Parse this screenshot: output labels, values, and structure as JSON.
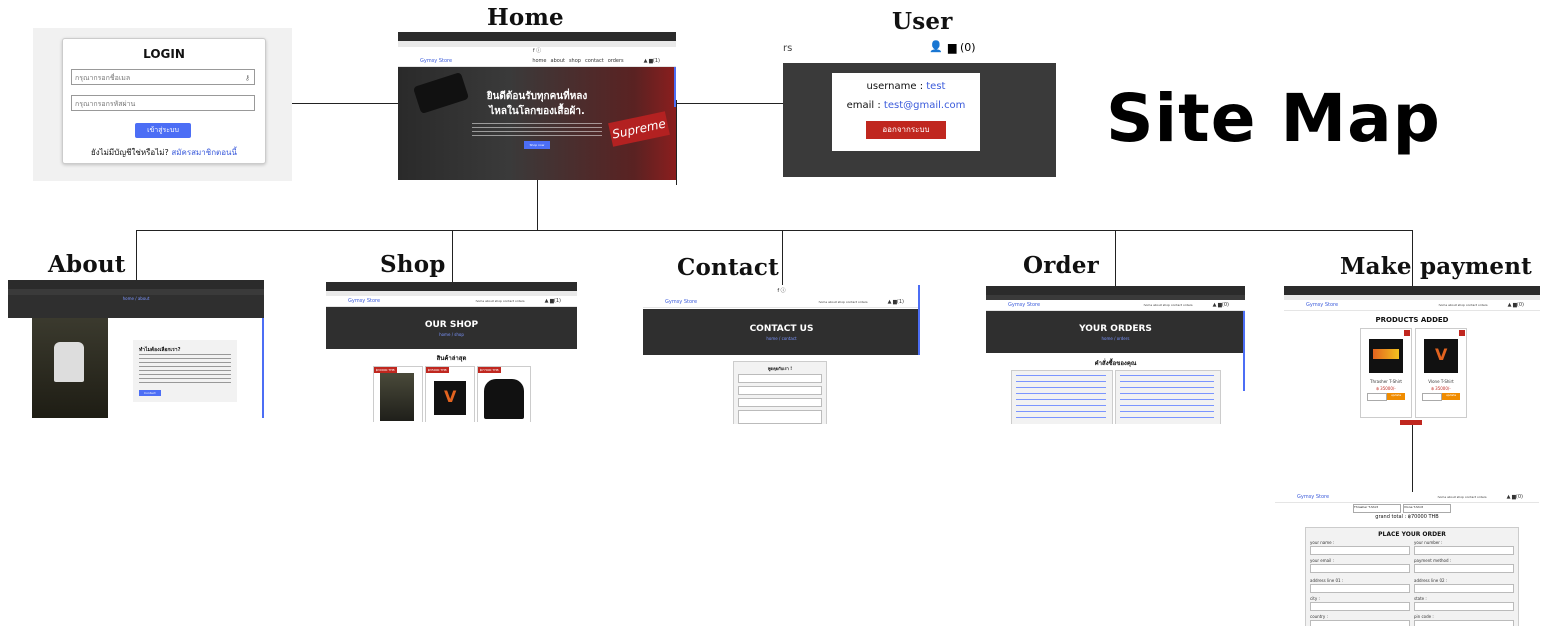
{
  "title": "Site Map",
  "labels": {
    "home": "Home",
    "user": "User",
    "about": "About",
    "shop": "Shop",
    "contact": "Contact",
    "order": "Order",
    "payment": "Make payment"
  },
  "login": {
    "title": "LOGIN",
    "username_placeholder": "กรุณากรอกชื่อเมล",
    "password_placeholder": "กรุณากรอกรหัสผ่าน",
    "submit": "เข้าสู่ระบบ",
    "no_account": "ยังไม่มีบัญชีใช่หรือไม่?",
    "register_link": "สมัครสมาชิกตอนนี้"
  },
  "home": {
    "brand": "Gymsy Store",
    "nav": [
      "home",
      "about",
      "shop",
      "contact",
      "orders"
    ],
    "cart": "(1)",
    "hero_title_1": "ยินดีต้อนรับทุกคนที่หลง",
    "hero_title_2": "ไหลในโลกของเสื้อผ้า.",
    "hero_button": "Shop now"
  },
  "user": {
    "nav_fragment": "rs",
    "cart": "(0)",
    "username_label": "username :",
    "username_value": "test",
    "email_label": "email :",
    "email_value": "test@gmail.com",
    "logout": "ออกจากระบบ"
  },
  "about": {
    "heading": "ทำไมต้องเลือกเรา?",
    "crumb": "home / about",
    "button": "Contact"
  },
  "shop": {
    "brand": "Gymsy Store",
    "hero_title": "OUR SHOP",
    "crumb": "home / shop",
    "section_title": "สินค้าล่าสุด",
    "tags": [
      "฿30000 THB",
      "฿35000 THB",
      "฿77000 THB"
    ]
  },
  "contact": {
    "brand": "Gymsy Store",
    "hero_title": "CONTACT US",
    "crumb": "home / contact",
    "form_title": "พูดคุยกับเรา !"
  },
  "order": {
    "brand": "Gymsy Store",
    "hero_title": "YOUR ORDERS",
    "crumb": "home / orders",
    "section_title": "คำสั่งซื้อของคุณ"
  },
  "payment": {
    "brand": "Gymsy Store",
    "products_title": "PRODUCTS ADDED",
    "items": [
      "Thrasher T-Shirt",
      "Vlone T-Shirt"
    ],
    "prices": [
      "฿ 35000/-",
      "฿ 35000/-"
    ],
    "update": "update",
    "place_title": "PLACE YOUR ORDER",
    "grand_total": "grand total : ฿70000 THB",
    "fields": [
      "your name :",
      "your number :",
      "your email :",
      "payment method :",
      "address line 01 :",
      "address line 02 :",
      "city :",
      "state :",
      "country :",
      "pin code :"
    ]
  }
}
